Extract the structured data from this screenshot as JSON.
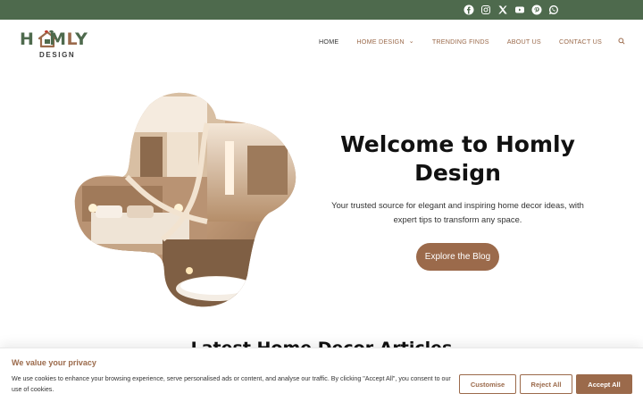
{
  "social": {
    "icons": [
      "facebook-icon",
      "instagram-icon",
      "x-icon",
      "youtube-icon",
      "pinterest-icon",
      "whatsapp-icon"
    ]
  },
  "brand": {
    "logo_word": "HOMLY",
    "logo_sub": "DESIGN",
    "colors": {
      "green": "#4e6a4d",
      "brown": "#9b6a4b"
    }
  },
  "nav": {
    "items": [
      {
        "label": "HOME",
        "active": true
      },
      {
        "label": "HOME DESIGN",
        "dropdown": true
      },
      {
        "label": "TRENDING FINDS"
      },
      {
        "label": "ABOUT US"
      },
      {
        "label": "CONTACT US"
      }
    ],
    "search_icon": "search-icon"
  },
  "hero": {
    "title": "Welcome to Homly Design",
    "subtitle": "Your trusted source for elegant and inspiring home decor ideas, with expert tips to transform any space.",
    "button": "Explore the Blog"
  },
  "section": {
    "title": "Latest Home Decor Articles"
  },
  "cookie": {
    "title": "We value your privacy",
    "text": "We use cookies to enhance your browsing experience, serve personalised ads or content, and analyse our traffic. By clicking \"Accept All\", you consent to our use of cookies.",
    "customise": "Customise",
    "reject": "Reject All",
    "accept": "Accept All"
  }
}
